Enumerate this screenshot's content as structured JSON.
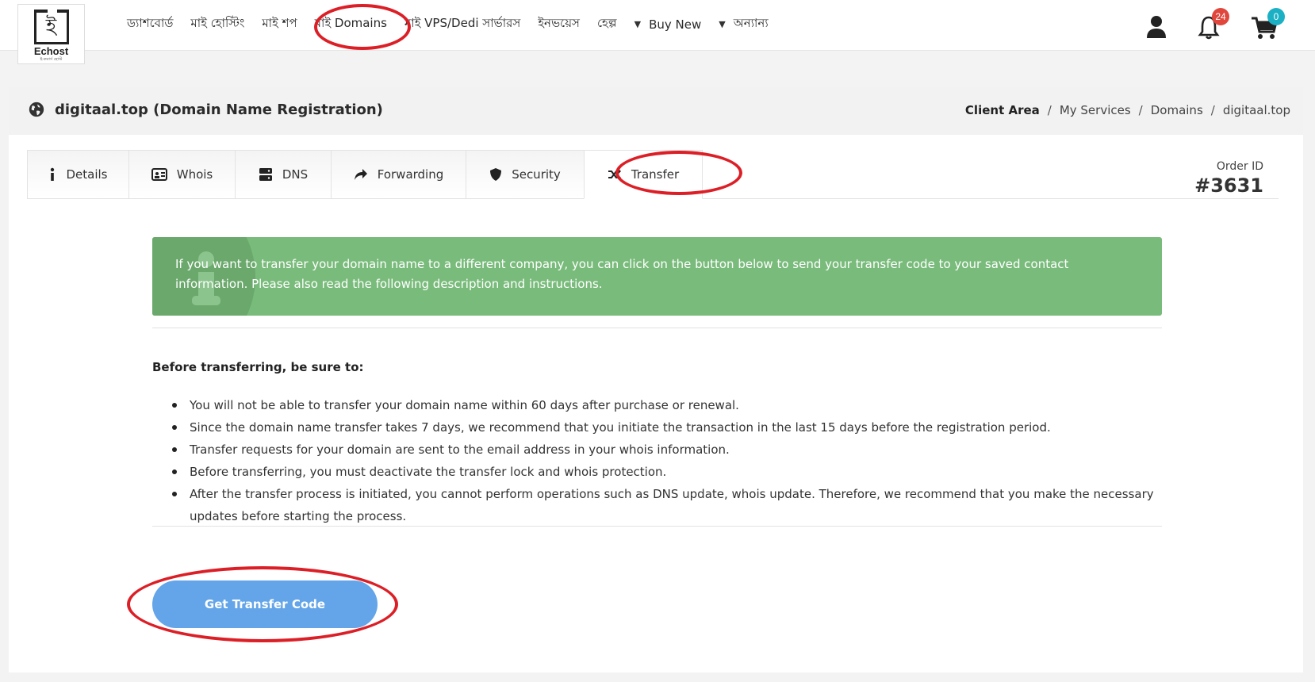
{
  "logo": {
    "name": "Echost",
    "tagline": "ই-কমার্স হোস্ট"
  },
  "nav": {
    "items": [
      "ড্যাশবোর্ড",
      "মাই হোস্টিং",
      "মাই শপ",
      "মাই Domains",
      "মাই VPS/Dedi সার্ভারস",
      "ইনভয়েস",
      "হেল্প"
    ],
    "buy_new": "Buy New",
    "others": "অন্যান্য"
  },
  "header_icons": {
    "notifications_count": "24",
    "cart_count": "0",
    "user_icon": "user-icon",
    "bell_icon": "bell-icon",
    "cart_icon": "cart-icon"
  },
  "page": {
    "title": "digitaal.top (Domain Name Registration)",
    "breadcrumb": [
      "Client Area",
      "My Services",
      "Domains",
      "digitaal.top"
    ]
  },
  "tabs": [
    {
      "label": "Details",
      "icon": "info-icon"
    },
    {
      "label": "Whois",
      "icon": "id-card-icon"
    },
    {
      "label": "DNS",
      "icon": "server-icon"
    },
    {
      "label": "Forwarding",
      "icon": "share-arrow-icon"
    },
    {
      "label": "Security",
      "icon": "shield-icon"
    },
    {
      "label": "Transfer",
      "icon": "shuffle-icon",
      "active": true
    }
  ],
  "order": {
    "label": "Order ID",
    "number": "#3631"
  },
  "alert": {
    "text": "If you want to transfer your domain name to a different company, you can click on the button below to send your transfer code to your saved contact information. Please also read the following description and instructions.",
    "color": "#79bb7b"
  },
  "instructions": {
    "title": "Before transferring, be sure to:",
    "items": [
      "You will not be able to transfer your domain name within 60 days after purchase or renewal.",
      "Since the domain name transfer takes 7 days, we recommend that you initiate the transaction in the last 15 days before the registration period.",
      "Transfer requests for your domain are sent to the email address in your whois information.",
      "Before transferring, you must deactivate the transfer lock and whois protection.",
      "After the transfer process is initiated, you cannot perform operations such as DNS update, whois update. Therefore, we recommend that you make the necessary updates before starting the process."
    ]
  },
  "action": {
    "button_label": "Get Transfer Code",
    "button_color": "#63a5e8"
  },
  "annotation_color": "#dc1f26"
}
